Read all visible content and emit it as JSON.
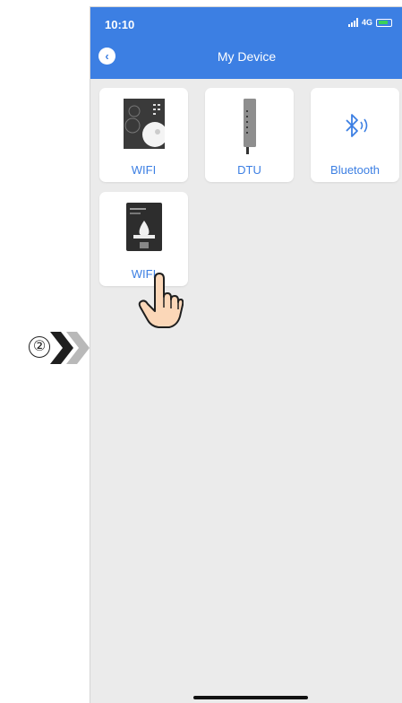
{
  "step": {
    "number": "②"
  },
  "status_bar": {
    "time": "10:10",
    "network": "4G"
  },
  "header": {
    "title": "My Device"
  },
  "devices": [
    {
      "label": "WIFI",
      "icon": "wifi-device-panel-icon"
    },
    {
      "label": "DTU",
      "icon": "dtu-device-icon"
    },
    {
      "label": "Bluetooth",
      "icon": "bluetooth-icon"
    },
    {
      "label": "WIFI",
      "icon": "wifi-device-screen-icon"
    }
  ],
  "colors": {
    "accent": "#3c7fe3",
    "background": "#ebebeb"
  }
}
